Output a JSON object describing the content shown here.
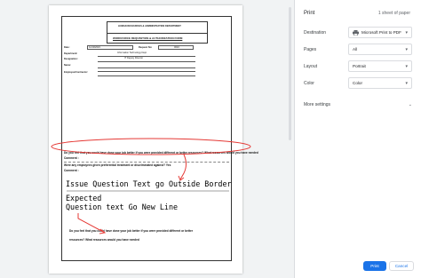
{
  "preview": {
    "form": {
      "department": "HUMAN RESOURCES & ADMINISTRATION DEPARTMENT",
      "title": "WORKFORCE REQUISITION & AUTHORIZATION FORM",
      "date_label": "Date:",
      "date_value": "11/10/2023",
      "request_label": "Request No:",
      "request_value": "0010",
      "department_label": "Department:",
      "department_value": "Information Technology Dept.",
      "designation_label": "Designation:",
      "designation_value": "IT Deputy Director",
      "name_label": "Name:",
      "employee_label": "Employee/Contractor:",
      "q1_text": "Do you feel that you could have done your job better if you were provided different or better resources? What resources would you have needed",
      "comment_label": "Comment :",
      "q2_text": "Were any employees given preferential treatment or discriminated against? Yes",
      "q3_line1": "Do you feel that you could have done your job better if you were provided different or better",
      "q3_line2": "resources? What resources would you have needed"
    },
    "annotation": {
      "issue_text": "Issue Question Text go Outside Border",
      "expected_label": "Expected",
      "expected_text": "Question text Go New Line"
    }
  },
  "settings": {
    "title": "Print",
    "sheet_count": "1 sheet of paper",
    "destination_label": "Destination",
    "destination_value": "Microsoft Print to PDF",
    "pages_label": "Pages",
    "pages_value": "All",
    "layout_label": "Layout",
    "layout_value": "Portrait",
    "color_label": "Color",
    "color_value": "Color",
    "more_settings": "More settings",
    "print_button": "Print",
    "cancel_button": "Cancel",
    "accent_color": "#1a73e8",
    "annotation_color": "#e53935"
  }
}
